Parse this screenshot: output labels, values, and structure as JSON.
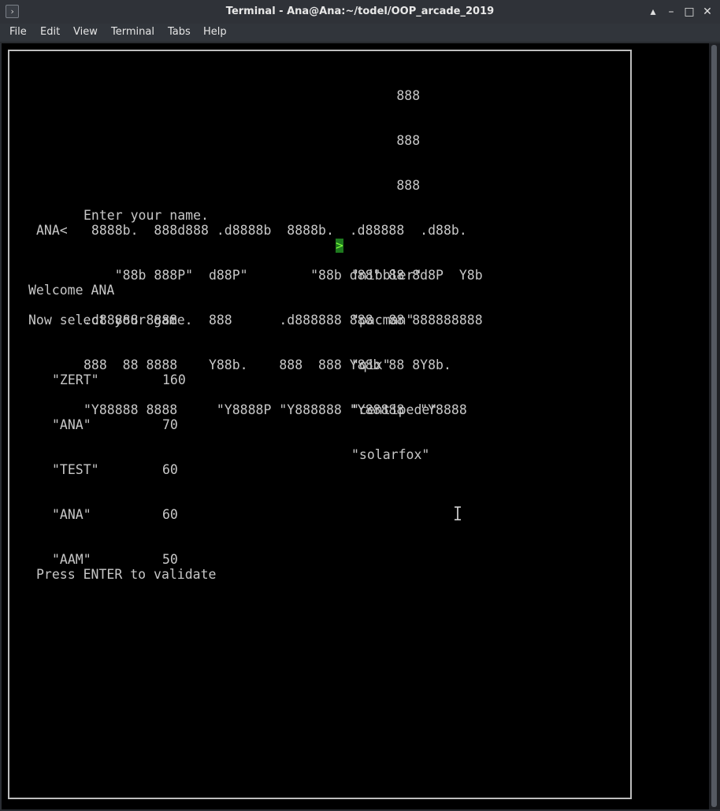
{
  "window": {
    "title": "Terminal - Ana@Ana:~/todel/OOP_arcade_2019",
    "app_icon_glyph": "›",
    "controls": {
      "up": "▴",
      "minimize": "–",
      "maximize": "□",
      "close": "✕"
    }
  },
  "menu": [
    "File",
    "Edit",
    "View",
    "Terminal",
    "Tabs",
    "Help"
  ],
  "terminal": {
    "logo_lines": [
      "                                        888",
      "                                        888",
      "                                        888",
      " 8888b.  888d888 .d8888b  8888b.  .d88888  .d88b.",
      "    \"88b 888P\"  d88P\"        \"88b d88\" 88 8d8P  Y8b",
      ".d88888 8888    888      .d888888 888  88 888888888",
      "888  88 8888    Y88b.    888  888 Y88b 88 8Y8b.",
      "\"Y88888 8888     \"Y8888P \"Y888888 \"Y88888  \"Y8888"
    ],
    "prompt": "Enter your name.",
    "name_input": "ANA<",
    "welcome": "Welcome ANA",
    "select_prompt": "Now select your game.",
    "selector_glyph": ">",
    "games": [
      "\"nibbler\"",
      "\"pacman\"",
      "\"qix\"",
      "\"centipede\"",
      "\"solarfox\""
    ],
    "scores": [
      {
        "name": "\"ZERT\"",
        "score": "160"
      },
      {
        "name": "\"ANA\"",
        "score": "70"
      },
      {
        "name": "\"TEST\"",
        "score": "60"
      },
      {
        "name": "\"ANA\"",
        "score": "60"
      },
      {
        "name": "\"AAM\"",
        "score": "50"
      }
    ],
    "footer": "Press ENTER to validate"
  }
}
